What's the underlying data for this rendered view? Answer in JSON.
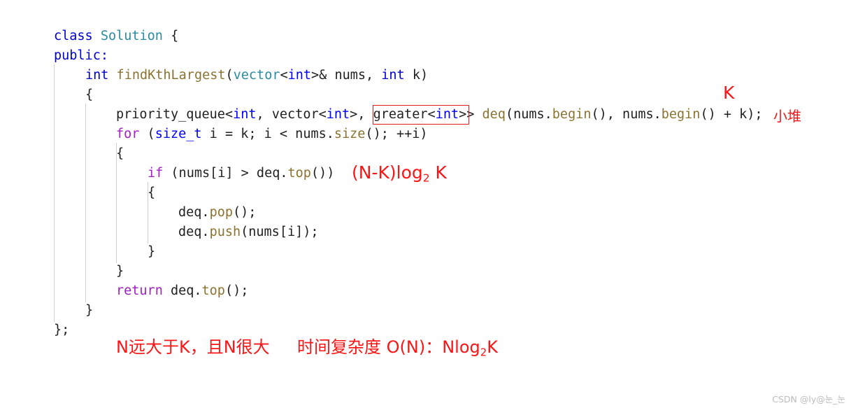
{
  "editor": {
    "language": "cpp",
    "background": "#ffffff",
    "default_text_color": "#1f1f1f",
    "indent_guide_color": "#d0d0d0",
    "lines": [
      {
        "indent": 0,
        "text": "class Solution {"
      },
      {
        "indent": 0,
        "text": "public:"
      },
      {
        "indent": 1,
        "text": "int findKthLargest(vector<int>& nums, int k)"
      },
      {
        "indent": 1,
        "text": "{"
      },
      {
        "indent": 2,
        "text": "priority_queue<int, vector<int>, greater<int>> deq(nums.begin(), nums.begin() + k);"
      },
      {
        "indent": 2,
        "text": "for (size_t i = k; i < nums.size(); ++i)"
      },
      {
        "indent": 2,
        "text": "{"
      },
      {
        "indent": 3,
        "text": "if (nums[i] > deq.top())"
      },
      {
        "indent": 3,
        "text": "{"
      },
      {
        "indent": 4,
        "text": "deq.pop();"
      },
      {
        "indent": 4,
        "text": "deq.push(nums[i]);"
      },
      {
        "indent": 3,
        "text": "}"
      },
      {
        "indent": 2,
        "text": "}"
      },
      {
        "indent": 2,
        "text": "return deq.top();"
      },
      {
        "indent": 1,
        "text": "}"
      },
      {
        "indent": 0,
        "text": "};"
      }
    ],
    "tokens": {
      "line1_kw": "class",
      "line1_type": "Solution",
      "line1_brace": " {",
      "line2_kw": "public:",
      "line3_kw": "int",
      "line3_fn": " findKthLargest",
      "line3_p1": "(",
      "line3_t1": "vector",
      "line3_lt": "<",
      "line3_int": "int",
      "line3_gt": ">& nums, ",
      "line3_kw2": "int",
      "line3_tail": " k)",
      "line4": "{",
      "line5_a": "priority_queue<",
      "line5_int1": "int",
      "line5_b": ", vector<",
      "line5_int2": "int",
      "line5_c": ">, ",
      "line5_greater": "greater<",
      "line5_int3": "int",
      "line5_d": ">",
      "line5_e": "> ",
      "line5_fn1": "deq",
      "line5_f": "(nums.",
      "line5_fn2": "begin",
      "line5_g": "(), nums.",
      "line5_fn3": "begin",
      "line5_h": "() + k);",
      "line6_kw": "for",
      "line6_a": " (",
      "line6_type": "size_t",
      "line6_b": " i = k; i < nums.",
      "line6_fn": "size",
      "line6_c": "(); ++i)",
      "line7": "{",
      "line8_kw": "if",
      "line8_a": " (nums[i] > deq.",
      "line8_fn": "top",
      "line8_b": "())",
      "line9": "{",
      "line10_a": "deq.",
      "line10_fn": "pop",
      "line10_b": "();",
      "line11_a": "deq.",
      "line11_fn": "push",
      "line11_b": "(nums[i]);",
      "line12": "}",
      "line13": "}",
      "line14_kw": "return",
      "line14_a": " deq.",
      "line14_fn": "top",
      "line14_b": "();",
      "line15": "}",
      "line16": "};"
    }
  },
  "highlight": {
    "boxed_expression": "greater<int>",
    "box_color": "#e01b1b"
  },
  "annotations": {
    "color": "#fa1616",
    "k_label": "K",
    "small_heap": "小堆",
    "complexity_main": "(N-K)log",
    "complexity_sub": "2",
    "complexity_tail": " K",
    "note": "N远大于K，且N很大",
    "time_label": "时间复杂度 O(N)：Nlog",
    "time_sub": "2",
    "time_tail": "K"
  },
  "watermark": {
    "text": "CSDN @ly@눈_눈",
    "color": "#bcbcbc"
  }
}
